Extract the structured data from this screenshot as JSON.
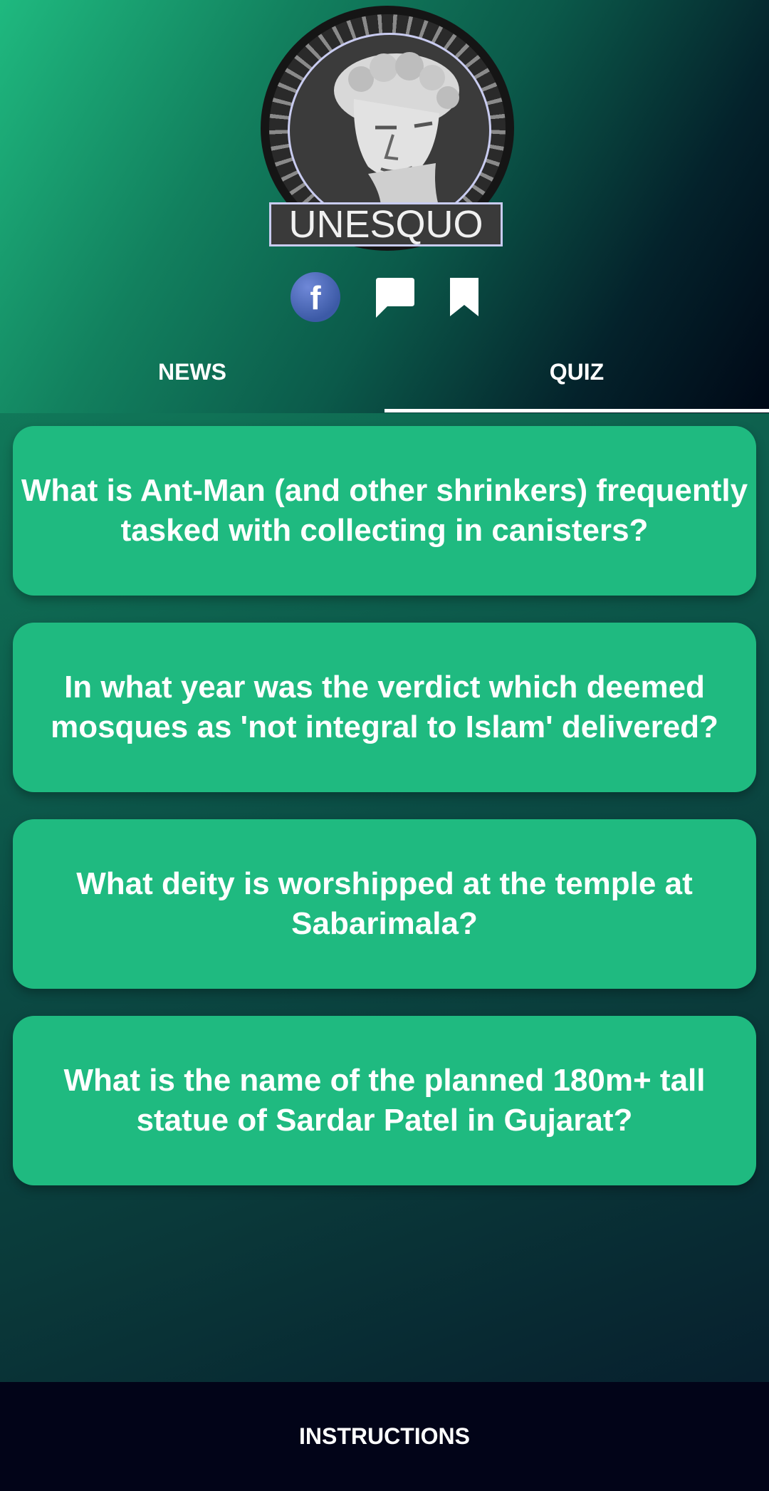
{
  "logo": {
    "text": "UNESQUO"
  },
  "socials": [
    {
      "icon": "facebook-icon",
      "label": "f"
    },
    {
      "icon": "chat-icon"
    },
    {
      "icon": "bookmark-icon"
    }
  ],
  "tabs": [
    {
      "label": "NEWS",
      "selected": false
    },
    {
      "label": "QUIZ",
      "selected": true
    }
  ],
  "questions": [
    "What is Ant-Man (and other shrinkers) frequently tasked with collecting in canisters?",
    "In what year was the verdict which deemed mosques as 'not integral to Islam' delivered?",
    "What deity is worshipped at the temple at Sabarimala?",
    "What is the name of the planned 180m+ tall statue of Sardar Patel in Gujarat?"
  ],
  "footer": {
    "label": "INSTRUCTIONS"
  },
  "colors": {
    "card": "#1fba80",
    "footer": "#020418",
    "accent": "#ffffff"
  }
}
